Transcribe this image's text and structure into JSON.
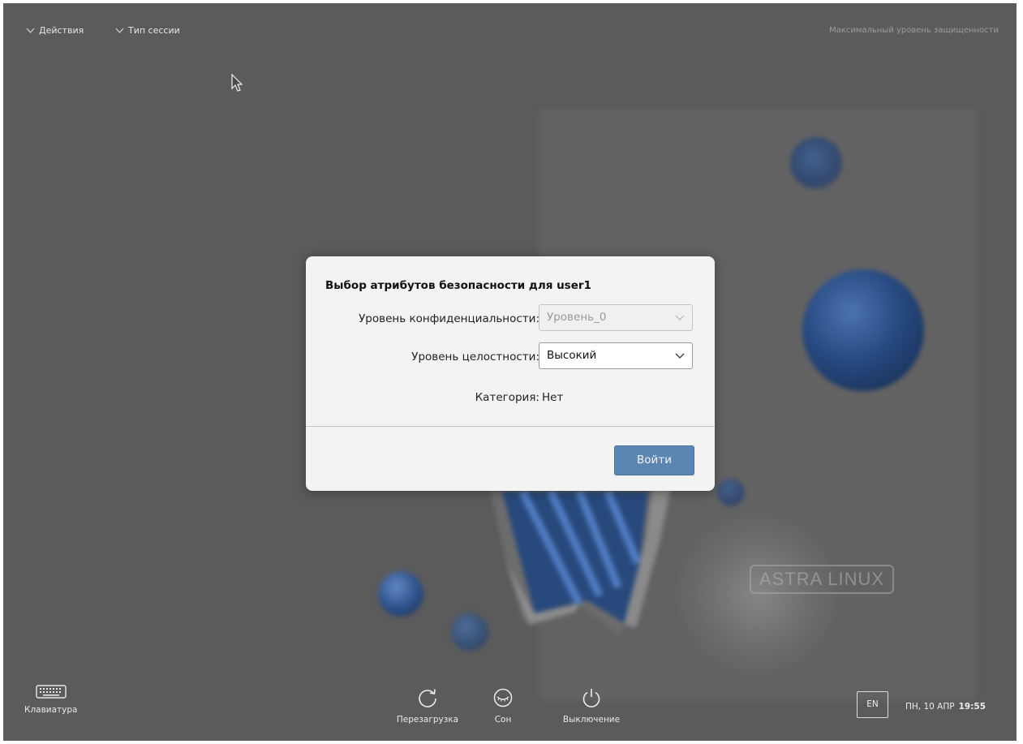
{
  "topbar": {
    "actions_label": "Действия",
    "session_type_label": "Тип сессии",
    "security_label": "Максимальный уровень защищенности"
  },
  "wallpaper": {
    "logo_text": "ASTRA LINUX",
    "accent_color": "#2c4f88"
  },
  "dialog": {
    "title": "Выбор атрибутов безопасности для user1",
    "confidentiality_label": "Уровень конфиденциальности:",
    "confidentiality_value": "Уровень_0",
    "integrity_label": "Уровень целостности:",
    "integrity_value": "Высокий",
    "category_label": "Категория:",
    "category_value": "Нет",
    "login_button": "Войти",
    "login_button_color": "#5b86b3"
  },
  "bottombar": {
    "keyboard_label": "Клавиатура",
    "restart_label": "Перезагрузка",
    "sleep_label": "Сон",
    "shutdown_label": "Выключение",
    "language": "EN",
    "date": "ПН, 10 АПР",
    "time": "19:55"
  }
}
